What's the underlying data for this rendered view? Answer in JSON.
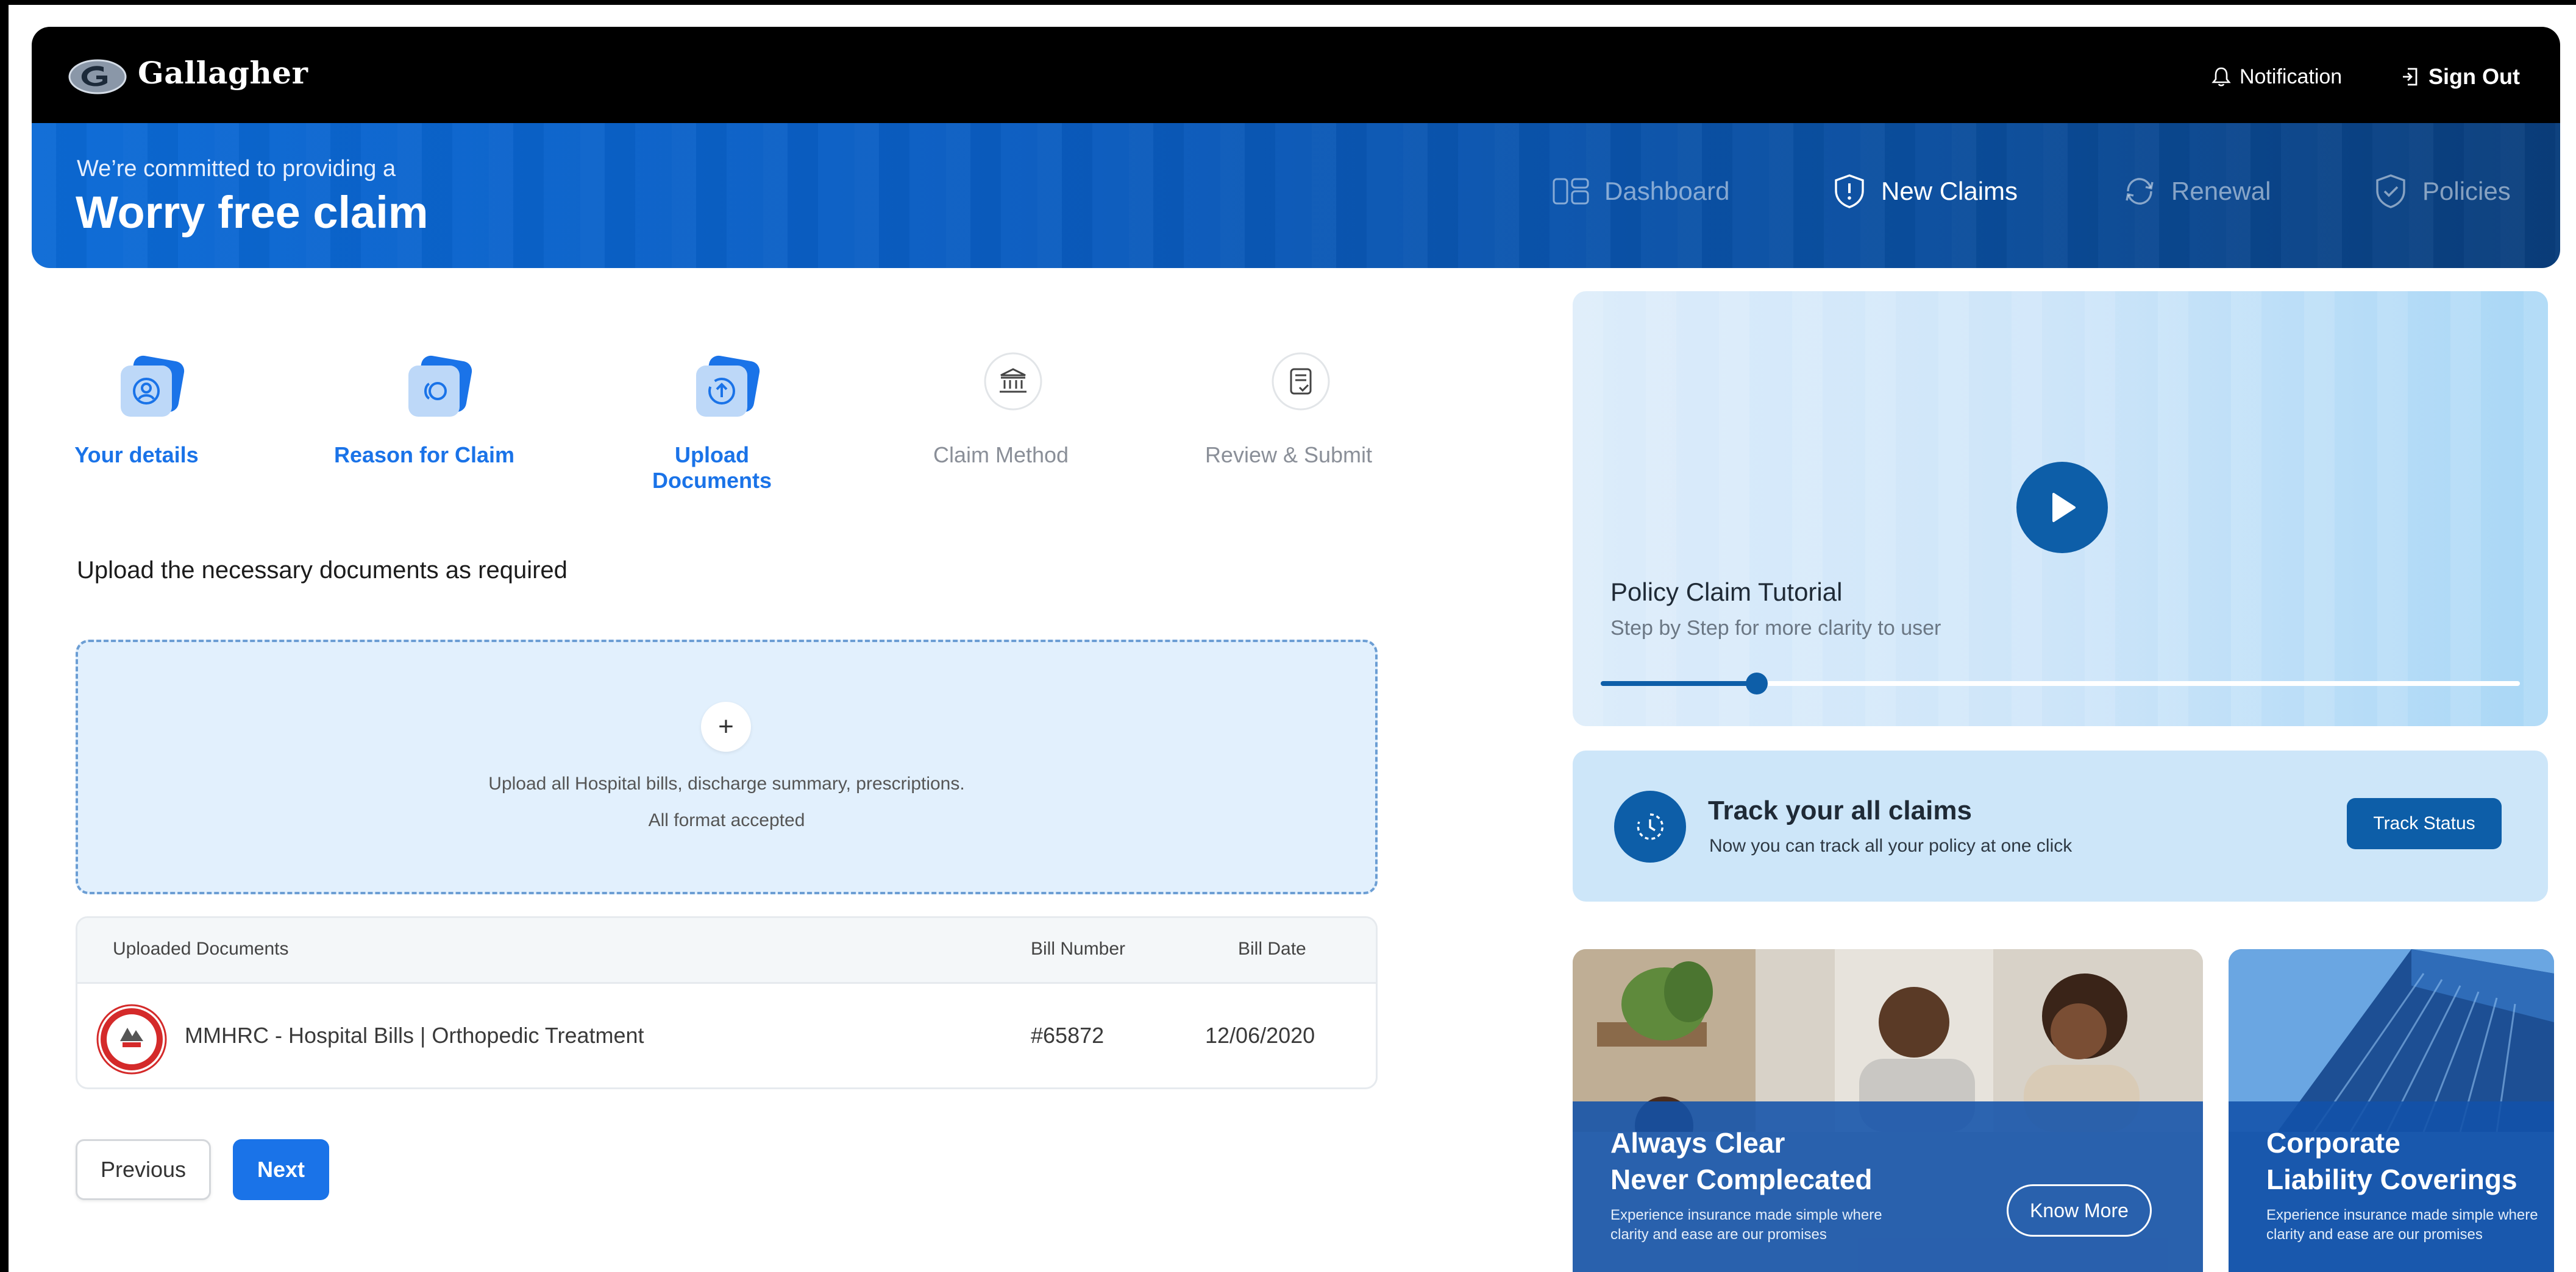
{
  "brand": {
    "name": "Gallagher"
  },
  "topbar": {
    "notification_label": "Notification",
    "signout_label": "Sign Out"
  },
  "hero": {
    "subtitle": "We’re committed to providing a",
    "title": "Worry free claim",
    "nav": [
      {
        "label": "Dashboard",
        "icon": "dashboard-icon",
        "active": false
      },
      {
        "label": "New Claims",
        "icon": "shield-alert-icon",
        "active": true
      },
      {
        "label": "Renewal",
        "icon": "refresh-icon",
        "active": false
      },
      {
        "label": "Policies",
        "icon": "shield-check-icon",
        "active": false
      }
    ]
  },
  "stepper": {
    "steps": [
      {
        "label": "Your details",
        "status": "done",
        "icon": "user-icon"
      },
      {
        "label": "Reason for Claim",
        "status": "done",
        "icon": "reason-icon"
      },
      {
        "label": "Upload Documents",
        "status": "current",
        "icon": "upload-icon"
      },
      {
        "label": "Claim Method",
        "status": "pending",
        "icon": "bank-icon"
      },
      {
        "label": "Review & Submit",
        "status": "pending",
        "icon": "checklist-icon"
      }
    ]
  },
  "upload": {
    "heading": "Upload the necessary documents as required",
    "dropzone_line1": "Upload all Hospital bills, discharge summary, prescriptions.",
    "dropzone_line2": "All format accepted"
  },
  "table": {
    "headers": {
      "documents": "Uploaded Documents",
      "bill_number": "Bill Number",
      "bill_date": "Bill Date"
    },
    "rows": [
      {
        "name": "MMHRC - Hospital Bills | Orthopedic Treatment",
        "bill_number": "#65872",
        "bill_date": "12/06/2020",
        "logo_text": "MMHRC"
      }
    ]
  },
  "actions": {
    "previous_label": "Previous",
    "next_label": "Next"
  },
  "tutorial": {
    "title": "Policy Claim Tutorial",
    "subtitle": "Step by Step for more clarity to user",
    "progress": 0.17
  },
  "track": {
    "title": "Track your all claims",
    "subtitle": "Now you can track all your policy at one click",
    "button_label": "Track Status"
  },
  "promos": [
    {
      "title_line1": "Always Clear",
      "title_line2": "Never Complecated",
      "text_line1": "Experience insurance made simple where",
      "text_line2": "clarity and ease are our promises",
      "button_label": "Know More"
    },
    {
      "title_line1": "Corporate",
      "title_line2": "Liability Coverings",
      "text_line1": "Experience insurance made simple where",
      "text_line2": "clarity and ease are our promises"
    }
  ],
  "colors": {
    "accent": "#1a73e8",
    "navy": "#0d5ea8",
    "hero_start": "#0b6ad6",
    "hero_end": "#0a3e7c"
  }
}
